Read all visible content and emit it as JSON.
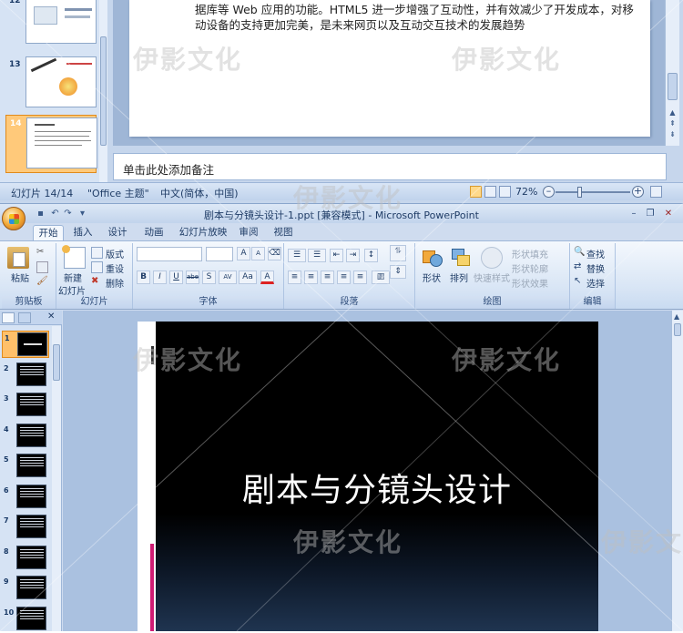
{
  "top_window": {
    "thumbnails": [
      {
        "num": "12"
      },
      {
        "num": "13"
      },
      {
        "num": "14",
        "selected": true
      }
    ],
    "slide_text": "据库等 Web 应用的功能。HTML5 进一步增强了互动性，并有效减少了开发成本，对移动设备的支持更加完美，是未来网页以及互动交互技术的发展趋势",
    "notes_placeholder": "单击此处添加备注",
    "status": {
      "slide_indicator": "幻灯片 14/14",
      "theme": "\"Office 主题\"",
      "language": "中文(简体，中国)",
      "zoom": "72%"
    }
  },
  "title_bar": {
    "title": "剧本与分镜头设计-1.ppt [兼容模式] - Microsoft PowerPoint",
    "minimize": "–",
    "restore": "❐",
    "close": "✕"
  },
  "ribbon_tabs": [
    "开始",
    "插入",
    "设计",
    "动画",
    "幻灯片放映",
    "审阅",
    "视图"
  ],
  "ribbon": {
    "clipboard": {
      "paste": "粘贴",
      "label": "剪贴板"
    },
    "slides": {
      "new_slide": "新建",
      "new_slide2": "幻灯片",
      "layout": "版式",
      "reset": "重设",
      "delete": "删除",
      "label": "幻灯片"
    },
    "font": {
      "bold": "B",
      "italic": "I",
      "underline": "U",
      "strike": "abe",
      "shadow": "S",
      "spacing": "AV",
      "case": "Aa",
      "color": "A",
      "grow": "A",
      "shrink": "A",
      "label": "字体"
    },
    "paragraph": {
      "label": "段落"
    },
    "drawing": {
      "shapes": "形状",
      "arrange": "排列",
      "quick_styles": "快速样式",
      "fill": "形状填充",
      "outline": "形状轮廓",
      "effects": "形状效果",
      "label": "绘图"
    },
    "editing": {
      "find": "查找",
      "replace": "替换",
      "select": "选择",
      "label": "编辑"
    }
  },
  "slide": {
    "title": "剧本与分镜头设计"
  },
  "left_pane": {
    "slide_numbers": [
      "1",
      "2",
      "3",
      "4",
      "5",
      "6",
      "7",
      "8",
      "9",
      "10"
    ],
    "close": "✕"
  },
  "watermark": "伊影文化",
  "colors": {
    "ribbon_bg": "#d8e5f5",
    "accent_selected": "#ffc06a",
    "slide_bg": "#000000",
    "pink_bar": "#d01c74"
  }
}
